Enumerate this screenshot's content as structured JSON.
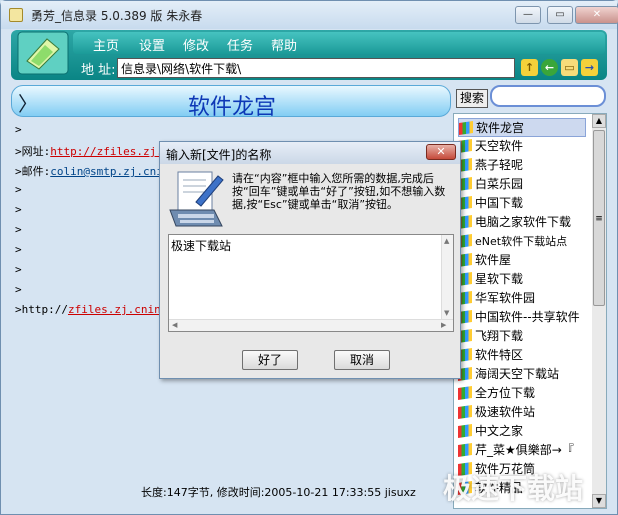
{
  "window": {
    "title": "勇芳_信息录  5.0.389 版  朱永春",
    "min_label": "—",
    "max_label": "▭",
    "close_label": "✕"
  },
  "menu": [
    "主页",
    "设置",
    "修改",
    "任务",
    "帮助"
  ],
  "address": {
    "label": "地 址:",
    "value": "信息录\\网络\\软件下载\\"
  },
  "header": {
    "chevron": "〉",
    "title": "软件龙宫"
  },
  "search": {
    "button_label": "搜索",
    "value": ""
  },
  "content": {
    "lines": [
      {
        "prefix": ">",
        "label": "",
        "link": ""
      },
      {
        "prefix": ">",
        "label": "网址:",
        "link": "http://zfiles.zj.c"
      },
      {
        "prefix": ">",
        "label": "邮件:",
        "link": "colin@smtp.zj.cnin"
      },
      {
        "prefix": ">",
        "label": "",
        "link": ""
      },
      {
        "prefix": ">",
        "label": "",
        "link": ""
      },
      {
        "prefix": ">",
        "label": "",
        "link": ""
      },
      {
        "prefix": ">",
        "label": "",
        "link": ""
      },
      {
        "prefix": ">",
        "label": "",
        "link": ""
      },
      {
        "prefix": ">",
        "label": "",
        "link": ""
      },
      {
        "prefix": ">",
        "label": "http://",
        "link": "zfiles.zj.cninfo"
      }
    ]
  },
  "status": {
    "text": "长度:147字节, 修改时间:2005-10-21 17:33:55 jisuxz"
  },
  "sidebar": {
    "items": [
      "软件龙宫",
      "天空软件",
      "燕子轻呢",
      "白菜乐园",
      "中国下载",
      "电脑之家软件下载",
      "eNet软件下载站点",
      "软件屋",
      "星软下载",
      "华军软件园",
      "中国软件--共享软件",
      "飞翔下载",
      "软件特区",
      "海阔天空下载站",
      "全方位下载",
      "极速软件站",
      "中文之家",
      "芹_菜★俱樂部→『",
      "软件万花筒",
      "软件精品"
    ],
    "selected_index": 0
  },
  "dialog": {
    "title": "输入新[文件]的名称",
    "close_label": "✕",
    "message": "请在“内容”框中输入您所需的数据,完成后按“回车”键或单击“好了”按钮,如不想输入数据,按“Esc”键或单击“取消”按钮。",
    "input_value": "极速下载站",
    "ok_label": "好了",
    "cancel_label": "取消"
  },
  "watermark": "极速下载站",
  "colors": {
    "accent": "#0a8585",
    "header_title": "#0d38b6",
    "link": "#cc0000"
  }
}
